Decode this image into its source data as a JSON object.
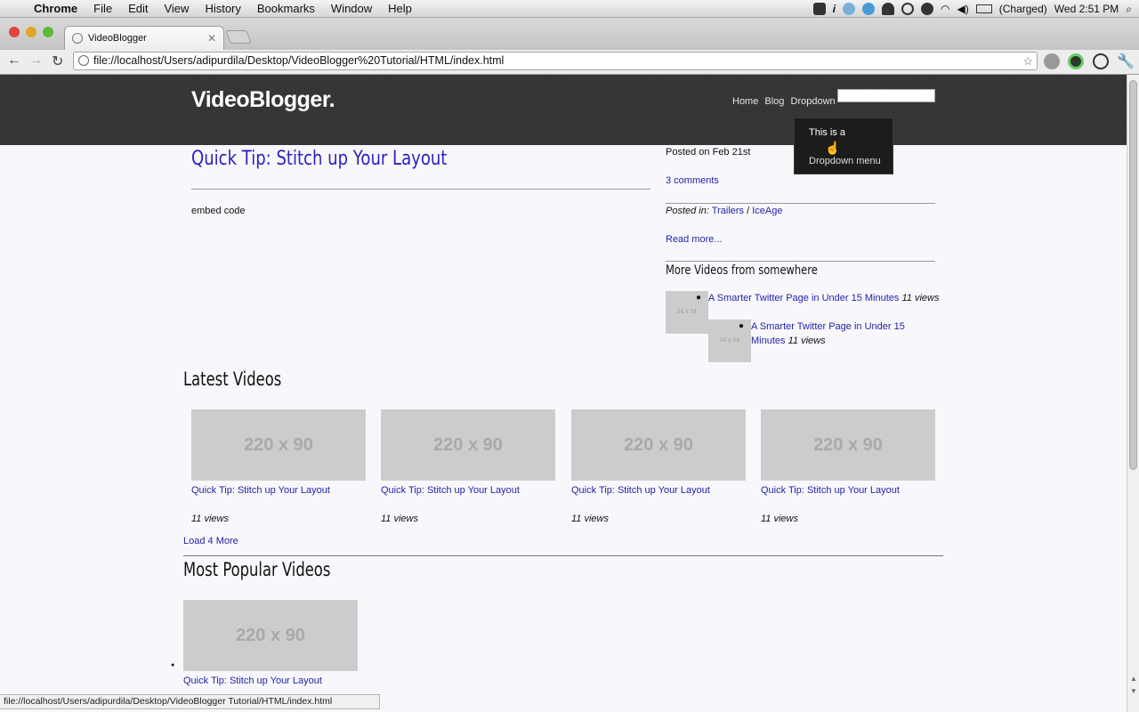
{
  "menubar": {
    "app_name": "Chrome",
    "menus": [
      "File",
      "Edit",
      "View",
      "History",
      "Bookmarks",
      "Window",
      "Help"
    ],
    "battery": "(Charged)",
    "clock": "Wed 2:51 PM"
  },
  "browser": {
    "tab_title": "VideoBlogger",
    "url": "file://localhost/Users/adipurdila/Desktop/VideoBlogger%20Tutorial/HTML/index.html",
    "status_url": "file://localhost/Users/adipurdila/Desktop/VideoBlogger Tutorial/HTML/index.html"
  },
  "site": {
    "logo": "VideoBlogger.",
    "nav": [
      "Home",
      "Blog",
      "Dropdown"
    ],
    "dropdown": [
      "This is a",
      "Dropdown menu"
    ]
  },
  "post": {
    "title": "Quick Tip: Stitch up Your Layout",
    "body": "embed code",
    "posted_on": "Posted on Feb 21st",
    "comments": "3 comments",
    "posted_in_label": "Posted in:",
    "categories": [
      "Trailers",
      "IceAge"
    ],
    "category_sep": " / ",
    "read_more": "Read more..."
  },
  "more_videos": {
    "heading": "More Videos from somewhere",
    "thumb_label": "54 x 54",
    "items": [
      {
        "title": "A Smarter Twitter Page in Under 15 Minutes",
        "views": "11 views"
      },
      {
        "title_line1": "A Smarter Twitter Page in Under 15",
        "title_line2": "Minutes",
        "views": "11 views"
      }
    ]
  },
  "latest": {
    "heading": "Latest Videos",
    "placeholder": "220 x 90",
    "cards": [
      {
        "title": "Quick Tip: Stitch up Your Layout",
        "views": "11 views"
      },
      {
        "title": "Quick Tip: Stitch up Your Layout",
        "views": "11 views"
      },
      {
        "title": "Quick Tip: Stitch up Your Layout",
        "views": "11 views"
      },
      {
        "title": "Quick Tip: Stitch up Your Layout",
        "views": "11 views"
      }
    ],
    "load_more": "Load 4 More"
  },
  "popular": {
    "heading": "Most Popular Videos",
    "placeholder": "220 x 90",
    "items": [
      {
        "title": "Quick Tip: Stitch up Your Layout"
      }
    ]
  }
}
